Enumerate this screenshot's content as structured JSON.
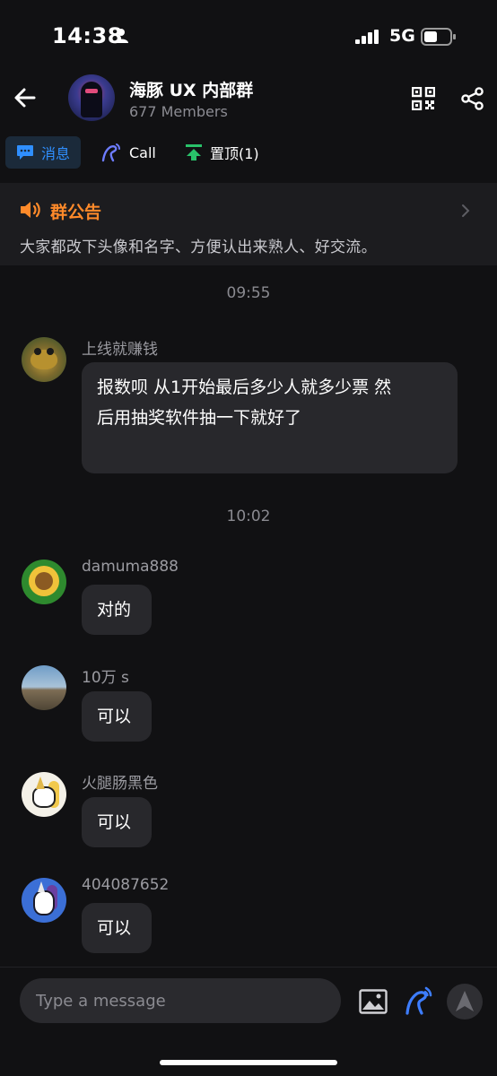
{
  "status_bar": {
    "time": "14:38",
    "network": "5G"
  },
  "header": {
    "title": "海豚 UX 内部群",
    "members": "677 Members"
  },
  "tabs": [
    {
      "label": "消息",
      "icon": "chat-icon",
      "active": true
    },
    {
      "label": "Call",
      "icon": "call-icon"
    },
    {
      "label": "置顶(1)",
      "icon": "pin-top-icon"
    }
  ],
  "announcement": {
    "title": "群公告",
    "text": "大家都改下头像和名字、方便认出来熟人、好交流。"
  },
  "messages": [
    {
      "type": "time",
      "text": "09:55"
    },
    {
      "type": "msg",
      "sender": "上线就赚钱",
      "lines": [
        "报数呗 从1开始最后多少人就多少票 然",
        "后用抽奖软件抽一下就好了"
      ]
    },
    {
      "type": "time",
      "text": "10:02"
    },
    {
      "type": "msg",
      "sender": "damuma888",
      "text": "对的"
    },
    {
      "type": "msg",
      "sender": "10万 s",
      "text": "可以"
    },
    {
      "type": "msg",
      "sender": "火腿肠黑色",
      "text": "可以"
    },
    {
      "type": "msg",
      "sender": "404087652",
      "text": "可以"
    }
  ],
  "composer": {
    "placeholder": "Type a message"
  },
  "colors": {
    "accent": "#2f8fff",
    "announce": "#ff8a2a",
    "pin": "#29c26a"
  }
}
